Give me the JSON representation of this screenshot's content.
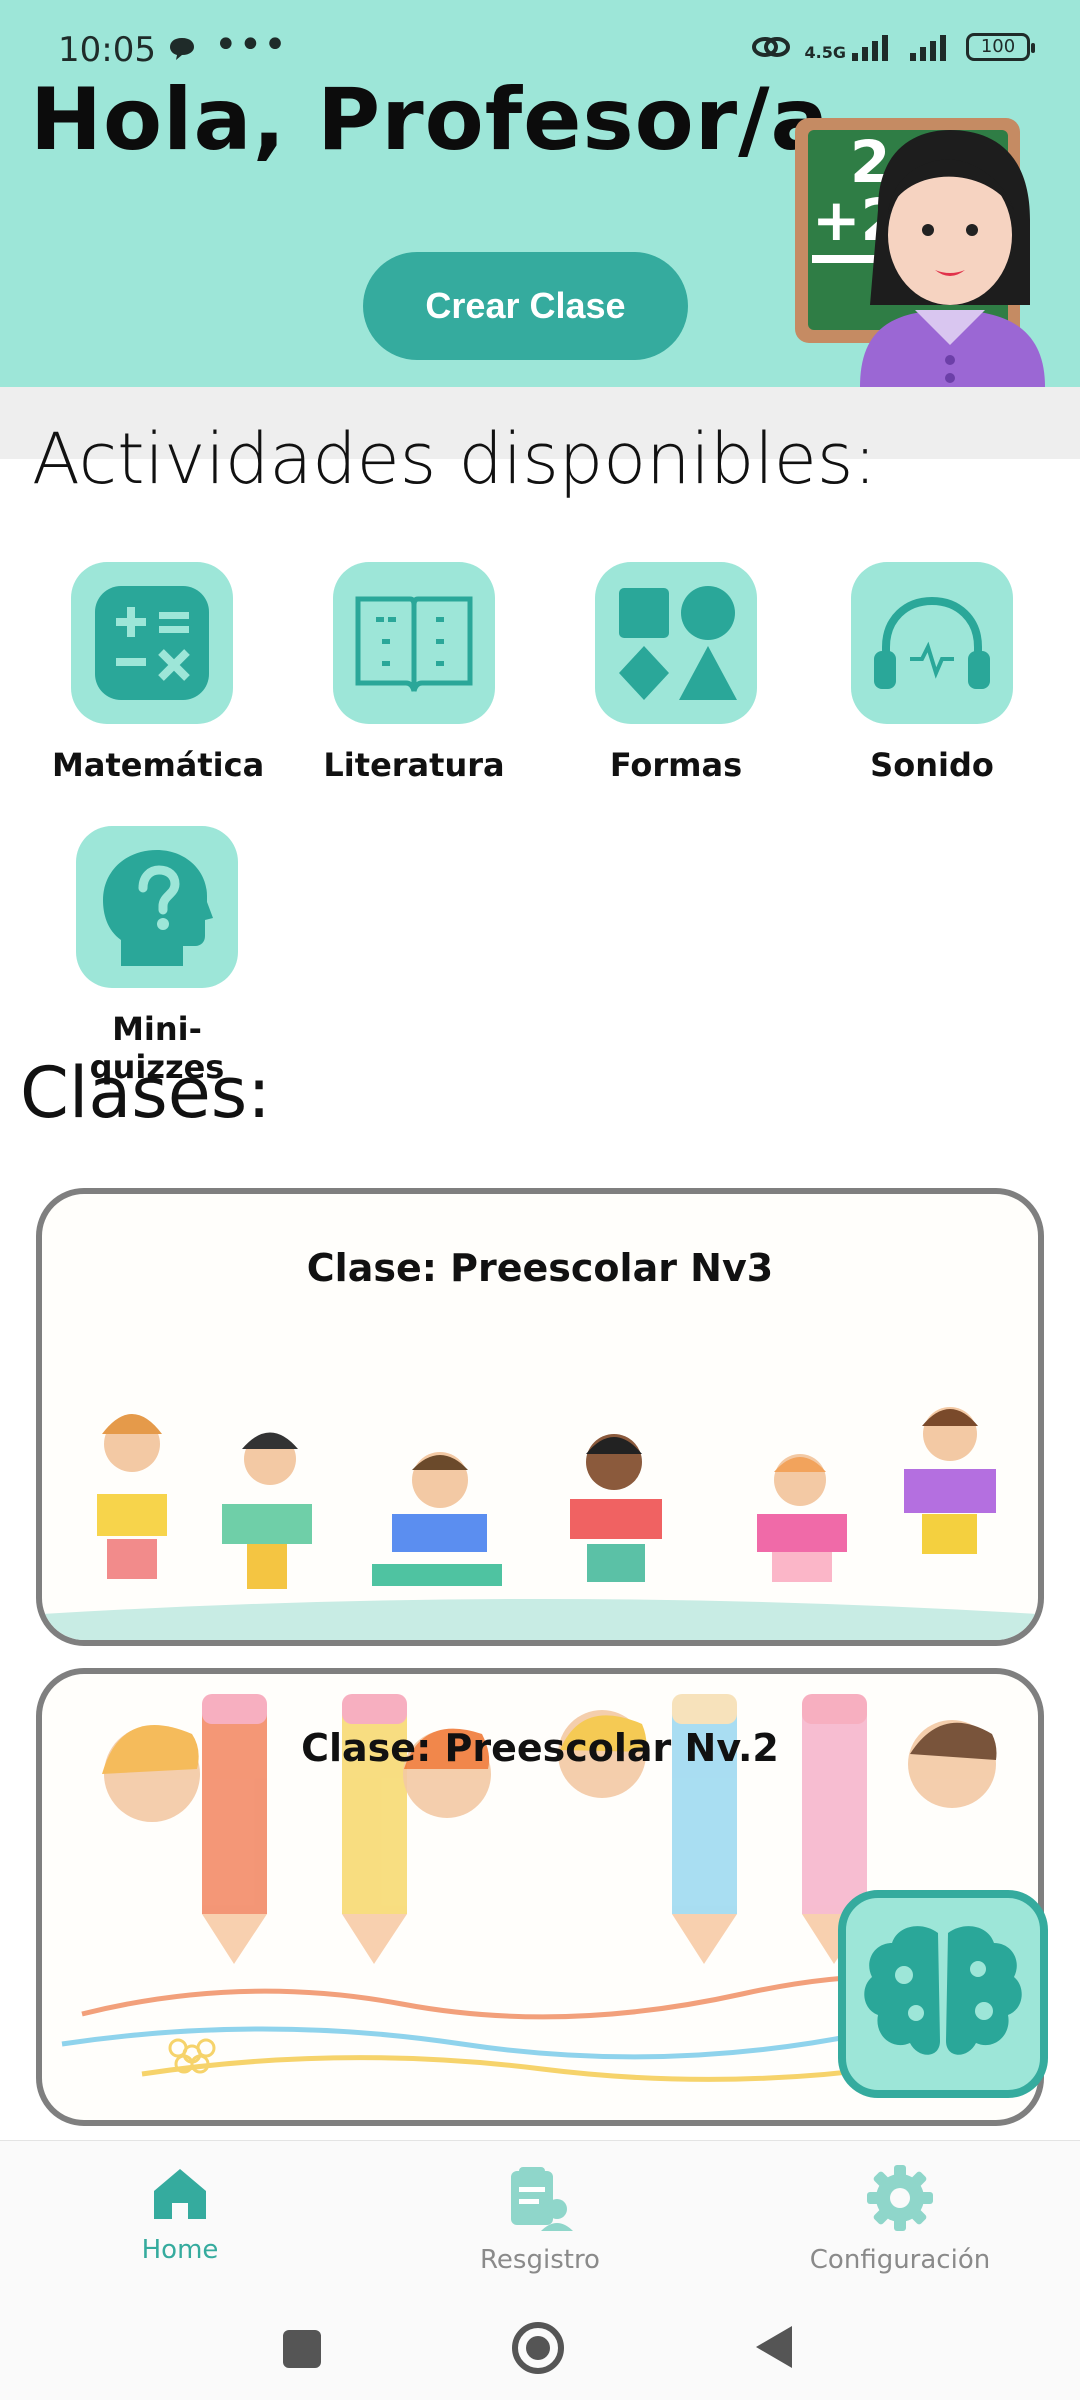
{
  "status_bar": {
    "time": "10:05",
    "dots": "•••",
    "network": "4.5G",
    "battery": "100"
  },
  "header": {
    "greeting": "Hola, Profesor/a",
    "create_button": "Crear Clase"
  },
  "activities": {
    "title": "Actividades disponibles:",
    "items": [
      {
        "label": "Matemática",
        "icon": "calculator-icon"
      },
      {
        "label": "Literatura",
        "icon": "book-icon"
      },
      {
        "label": "Formas",
        "icon": "shapes-icon"
      },
      {
        "label": "Sonido",
        "icon": "headphones-icon"
      },
      {
        "label": "Mini-quizzes",
        "icon": "question-head-icon"
      }
    ]
  },
  "classes": {
    "title": "Clases:",
    "items": [
      {
        "title": "Clase: Preescolar Nv3"
      },
      {
        "title": "Clase: Preescolar Nv.2"
      }
    ]
  },
  "nav": {
    "items": [
      {
        "label": "Home",
        "icon": "home-icon",
        "active": true
      },
      {
        "label": "Resgistro",
        "icon": "register-icon",
        "active": false
      },
      {
        "label": "Configuración",
        "icon": "gear-icon",
        "active": false
      }
    ]
  },
  "colors": {
    "accent": "#35ab9e",
    "header_bg": "#9de6d8",
    "inactive": "#8a8a8a"
  }
}
